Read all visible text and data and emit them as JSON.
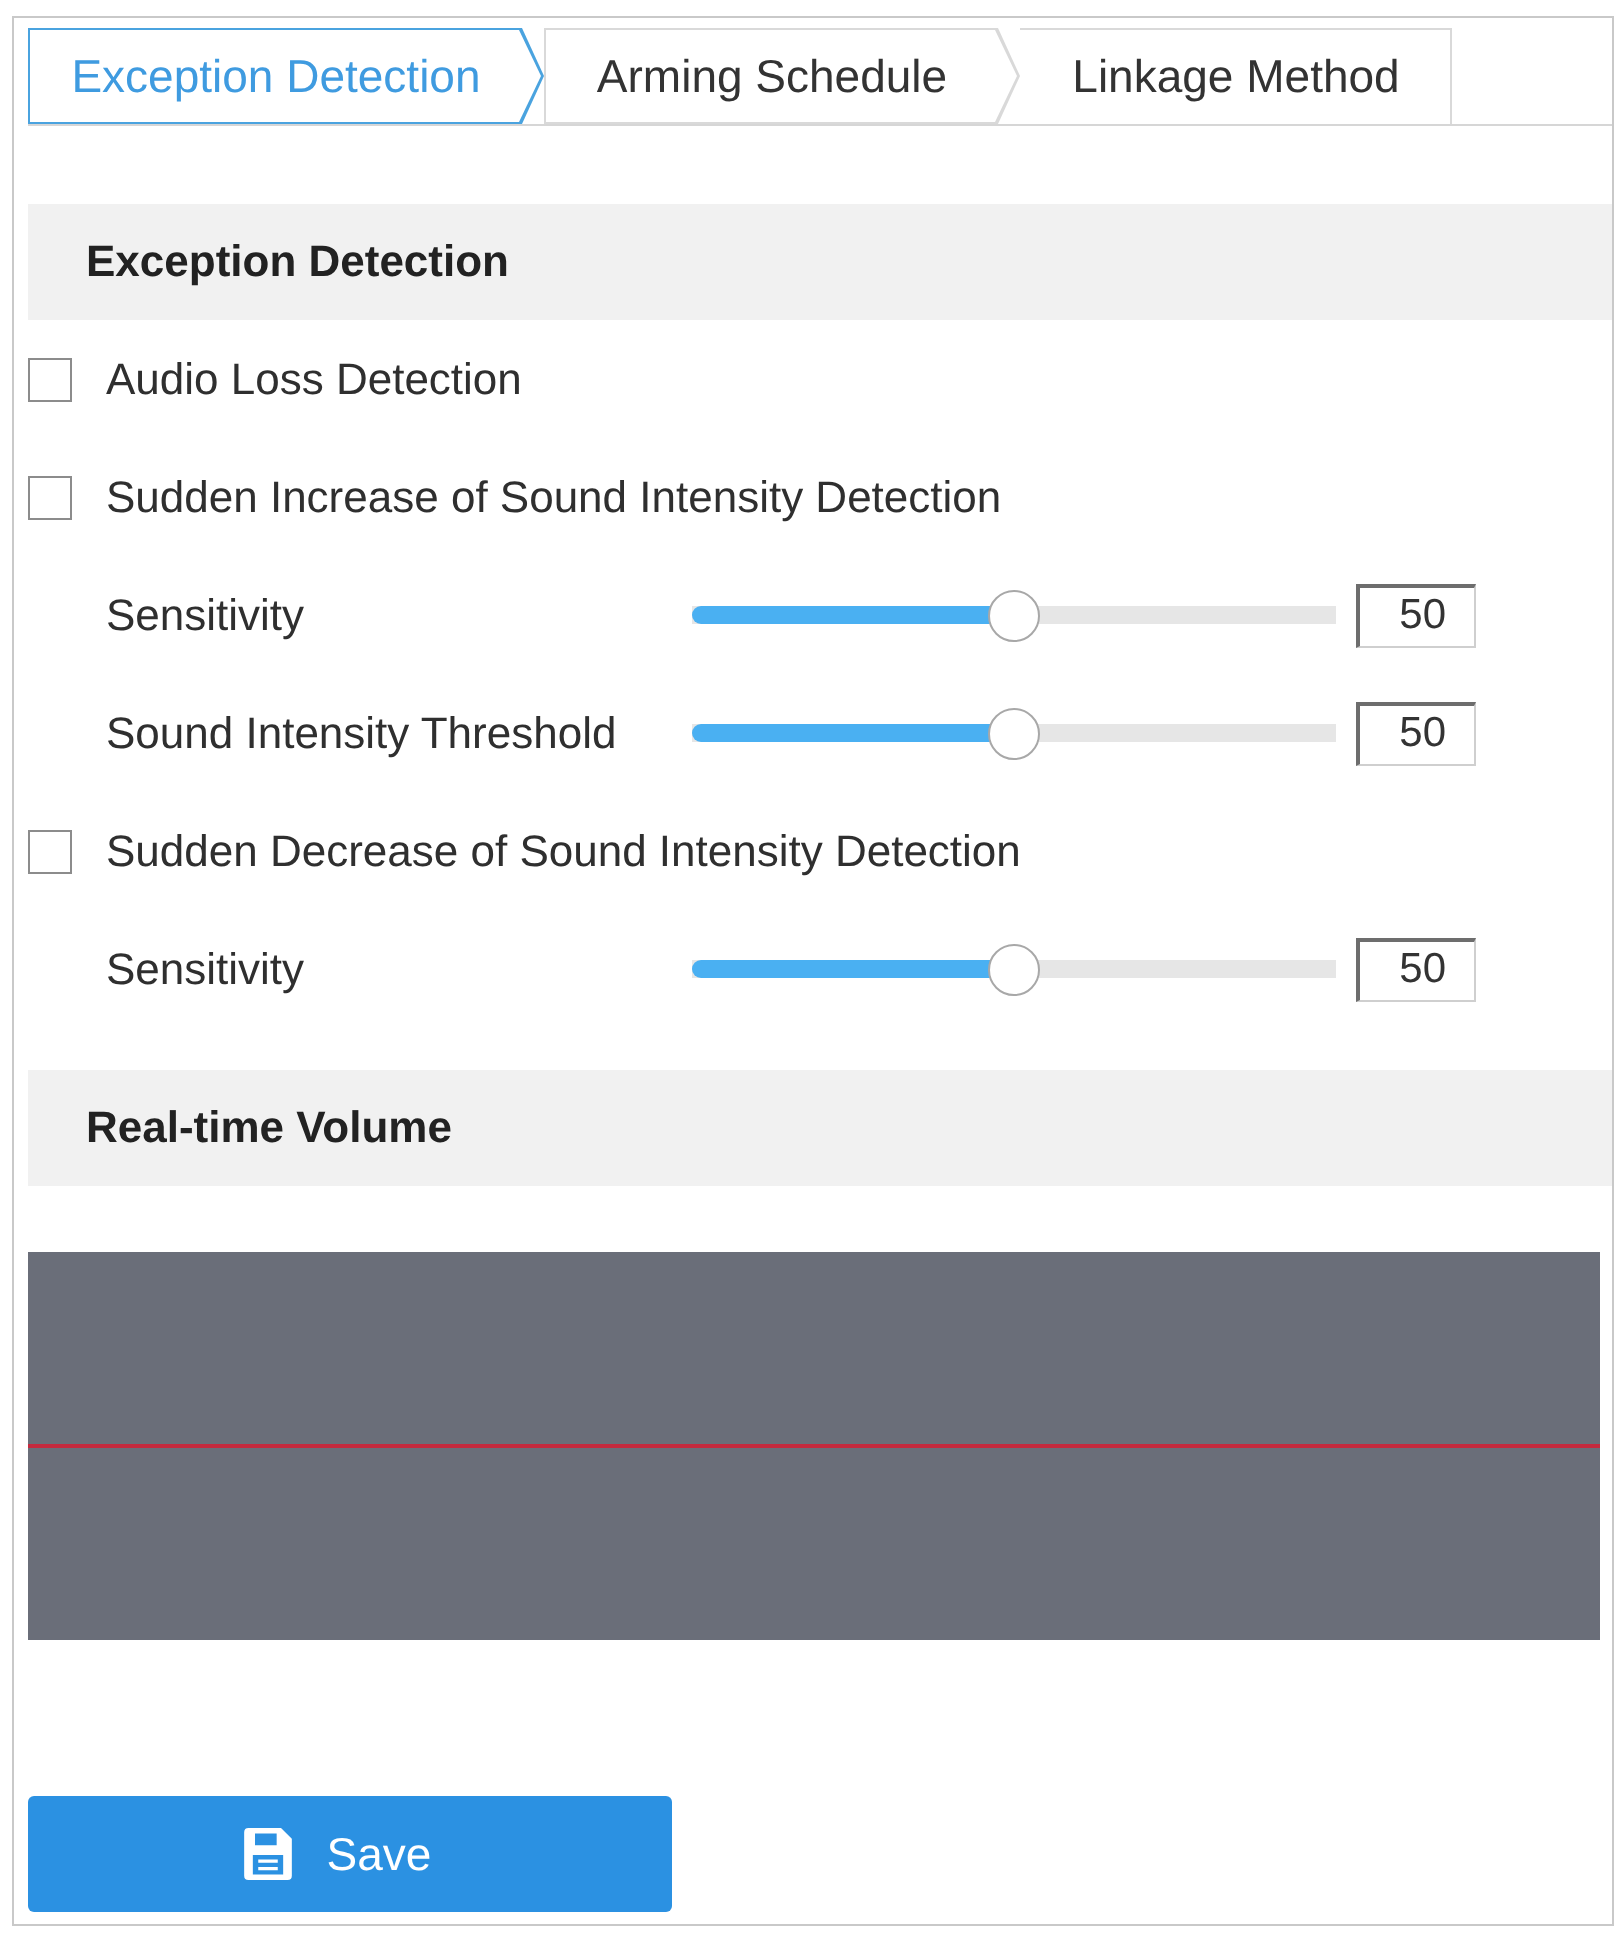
{
  "tabs": [
    {
      "label": "Exception Detection",
      "selected": true
    },
    {
      "label": "Arming Schedule",
      "selected": false
    },
    {
      "label": "Linkage Method",
      "selected": false
    }
  ],
  "exception_detection": {
    "title": "Exception Detection",
    "items": [
      {
        "kind": "checkbox",
        "label": "Audio Loss Detection",
        "checked": false
      },
      {
        "kind": "checkbox",
        "label": "Sudden Increase of Sound Intensity Detection",
        "checked": false
      },
      {
        "kind": "slider",
        "label": "Sensitivity",
        "level": 0.5,
        "value": "50"
      },
      {
        "kind": "slider",
        "label": "Sound Intensity Threshold",
        "level": 0.5,
        "value": "50"
      },
      {
        "kind": "checkbox",
        "label": "Sudden Decrease of Sound Intensity Detection",
        "checked": false
      },
      {
        "kind": "slider",
        "label": "Sensitivity",
        "level": 0.5,
        "value": "50"
      }
    ]
  },
  "real_time_volume": {
    "title": "Real-time Volume"
  },
  "save_button": {
    "label": "Save"
  }
}
